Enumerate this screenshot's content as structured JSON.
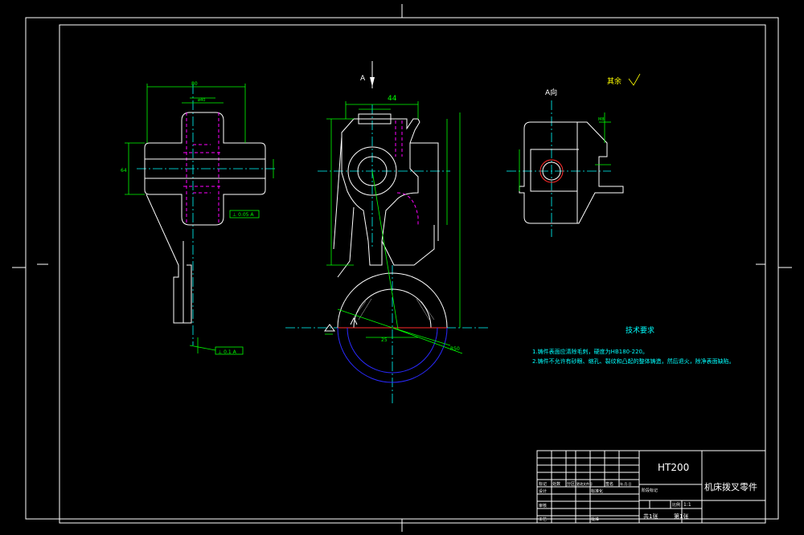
{
  "colors": {
    "background": "#000000",
    "outline": "#ffffff",
    "dimension": "#00ff00",
    "centerline": "#00ffff",
    "hidden": "#ff00ff",
    "tech_title": "#00ffff",
    "tech_text": "#00ffff",
    "annotation": "#ffff00"
  },
  "views": {
    "view_a_label": "A向",
    "section_a_marker": "A",
    "roughness_other": "其余",
    "dim_44": "44",
    "dim_r50": "R50",
    "dim_25": "25",
    "dim_m8": "M8"
  },
  "tech_requirements": {
    "title": "技术要求",
    "items": [
      "1.铸件表面应清除毛刺，硬度为HB180-220。",
      "2.铸件不允许有砂眼、缩孔、裂纹和凸起的整体铸造，然后退火，除净表面缺陷。"
    ]
  },
  "title_block": {
    "material": "HT200",
    "part_name": "机床拨叉零件",
    "scale": "1:1",
    "sheets_total": "共1张",
    "sheet_number": "第1张",
    "designer_label": "设计",
    "checker_label": "审核",
    "process_label": "工艺",
    "approve_label": "批准",
    "standard_label": "标准化",
    "marker_label": "标记",
    "count_label": "处数",
    "zone_label": "分区",
    "change_doc_label": "更改文件号",
    "signature_label": "签名",
    "date_label": "年.月.日",
    "stage_label": "阶段标记",
    "weight_label": "重量",
    "ratio_label": "比例"
  }
}
